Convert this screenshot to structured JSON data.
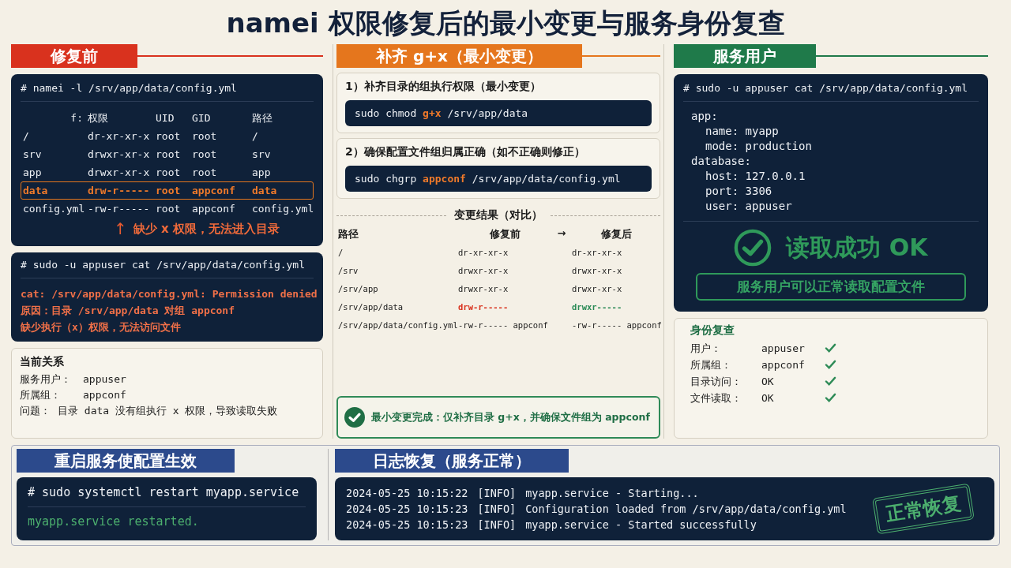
{
  "title": "namei 权限修复后的最小变更与服务身份复查",
  "before": {
    "header": "修复前",
    "namei": {
      "command": "# namei -l /srv/app/data/config.yml",
      "columns": [
        "f:",
        "权限",
        "UID",
        "GID",
        "路径"
      ],
      "rows": [
        {
          "cells": [
            "/",
            "dr-xr-xr-x",
            "root",
            "root",
            "/"
          ],
          "highlighted": false
        },
        {
          "cells": [
            "srv",
            "drwxr-xr-x",
            "root",
            "root",
            "srv"
          ],
          "highlighted": false
        },
        {
          "cells": [
            "app",
            "drwxr-xr-x",
            "root",
            "root",
            "app"
          ],
          "highlighted": false
        },
        {
          "cells": [
            "data",
            "drw-r-----",
            "root",
            "appconf",
            "data"
          ],
          "highlighted": true
        },
        {
          "cells": [
            "config.yml",
            "-rw-r-----",
            "root",
            "appconf",
            "config.yml"
          ],
          "highlighted": false
        }
      ],
      "note_arrow": "↑",
      "note": "缺少 x 权限，无法进入目录"
    },
    "cat": {
      "command": "# sudo -u appuser cat /srv/app/data/config.yml",
      "lines": [
        "cat: /srv/app/data/config.yml: Permission denied",
        "原因：目录 /srv/app/data 对组 appconf",
        "缺少执行（x）权限，无法访问文件"
      ]
    },
    "relation": {
      "title": "当前关系",
      "rows": [
        {
          "label": "服务用户：",
          "value": "appuser"
        },
        {
          "label": "所属组：",
          "value": "appconf"
        },
        {
          "label": "问题：",
          "value": "目录 data 没有组执行 x 权限，导致读取失败"
        }
      ]
    }
  },
  "fix": {
    "header": "补齐 g+x（最小变更）",
    "steps": [
      {
        "title": "1）补齐目录的组执行权限（最小变更）",
        "command": [
          {
            "text": "sudo chmod ",
            "highlight": false
          },
          {
            "text": "g+x",
            "highlight": true
          },
          {
            "text": " /srv/app/data",
            "highlight": false
          }
        ]
      },
      {
        "title": "2）确保配置文件组归属正确（如不正确则修正）",
        "command": [
          {
            "text": "sudo chgrp ",
            "highlight": false
          },
          {
            "text": "appconf",
            "highlight": true
          },
          {
            "text": " /srv/app/data/config.yml",
            "highlight": false
          }
        ]
      }
    ],
    "comparison": {
      "title": "变更结果（对比）",
      "columns": [
        "路径",
        "修复前",
        "→",
        "修复后"
      ],
      "rows": [
        {
          "path": "/",
          "before": "dr-xr-xr-x",
          "after": "dr-xr-xr-x",
          "changed": false
        },
        {
          "path": "/srv",
          "before": "drwxr-xr-x",
          "after": "drwxr-xr-x",
          "changed": false
        },
        {
          "path": "/srv/app",
          "before": "drwxr-xr-x",
          "after": "drwxr-xr-x",
          "changed": false
        },
        {
          "path": "/srv/app/data",
          "before": "drw-r-----",
          "after": "drwxr-----",
          "changed": true
        },
        {
          "path": "/srv/app/data/config.yml",
          "before": "-rw-r----- appconf",
          "after": "-rw-r----- appconf",
          "changed": false
        }
      ]
    },
    "done": "最小变更完成：仅补齐目录 g+x，并确保文件组为 appconf"
  },
  "service": {
    "header": "服务用户",
    "command": "# sudo -u appuser cat /srv/app/data/config.yml",
    "yaml": [
      {
        "text": "app:",
        "children": [
          {
            "text": "name: myapp"
          },
          {
            "text": "mode: production"
          }
        ]
      },
      {
        "text": "database:",
        "children": [
          {
            "text": "host: 127.0.0.1"
          },
          {
            "text": "port: 3306"
          },
          {
            "text": "user: appuser"
          }
        ]
      }
    ],
    "result": "读取成功 OK",
    "result_note": "服务用户可以正常读取配置文件",
    "identity": {
      "title": "身份复查",
      "rows": [
        {
          "label": "用户：",
          "value": "appuser",
          "checked": true
        },
        {
          "label": "所属组：",
          "value": "appconf",
          "checked": true
        },
        {
          "label": "目录访问：",
          "value": "OK",
          "checked": true
        },
        {
          "label": "文件读取：",
          "value": "OK",
          "checked": true
        }
      ]
    }
  },
  "restart": {
    "header": "重启服务使配置生效",
    "command": "# sudo systemctl restart myapp.service",
    "output": "myapp.service restarted."
  },
  "logs": {
    "header": "日志恢复（服务正常）",
    "lines": [
      {
        "time": "2024-05-25 10:15:22",
        "level": "[INFO]",
        "message": "myapp.service - Starting..."
      },
      {
        "time": "2024-05-25 10:15:23",
        "level": "[INFO]",
        "message": "Configuration loaded from /srv/app/data/config.yml"
      },
      {
        "time": "2024-05-25 10:15:23",
        "level": "[INFO]",
        "message": "myapp.service - Started successfully"
      }
    ],
    "stamp": "正常恢复"
  }
}
